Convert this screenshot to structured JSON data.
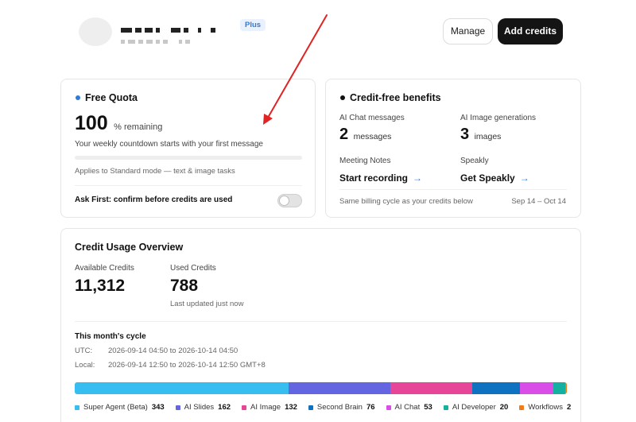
{
  "header": {
    "plan_badge": "Plus",
    "manage_label": "Manage",
    "add_credits_label": "Add credits"
  },
  "free_quota": {
    "title": "Free Quota",
    "percent": "100",
    "percent_suffix": "% remaining",
    "countdown_note": "Your weekly countdown starts with your first message",
    "used_fraction": 0,
    "applies_note": "Applies to Standard mode — text & image tasks",
    "ask_first_label": "Ask First: confirm before credits are used",
    "ask_first_enabled": false,
    "dot_color": "#2f7bd8"
  },
  "benefits": {
    "title": "Credit-free benefits",
    "chat_label": "AI Chat messages",
    "chat_count": "2",
    "chat_unit": "messages",
    "image_label": "AI Image generations",
    "image_count": "3",
    "image_unit": "images",
    "meeting_label": "Meeting Notes",
    "meeting_action": "Start recording",
    "speakly_label": "Speakly",
    "speakly_action": "Get Speakly",
    "arrow": "→",
    "billing_note": "Same billing cycle as your credits below",
    "billing_range": "Sep 14 – Oct 14"
  },
  "usage": {
    "title": "Credit Usage Overview",
    "available_label": "Available Credits",
    "available_value": "11,312",
    "used_label": "Used Credits",
    "used_value": "788",
    "updated_note": "Last updated just now",
    "cycle_title": "This month's cycle",
    "utc_label": "UTC:",
    "utc_range": "2026-09-14 04:50 to 2026-10-14 04:50",
    "local_label": "Local:",
    "local_range": "2026-09-14 12:50 to 2026-10-14 12:50 GMT+8",
    "segments": [
      {
        "name": "Super Agent (Beta)",
        "value": "343",
        "amount": 343,
        "color": "#38bdf0"
      },
      {
        "name": "AI Slides",
        "value": "162",
        "amount": 162,
        "color": "#6366e0"
      },
      {
        "name": "AI Image",
        "value": "132",
        "amount": 132,
        "color": "#e64598"
      },
      {
        "name": "Second Brain",
        "value": "76",
        "amount": 76,
        "color": "#0e72c0"
      },
      {
        "name": "AI Chat",
        "value": "53",
        "amount": 53,
        "color": "#d84ee6"
      },
      {
        "name": "AI Developer",
        "value": "20",
        "amount": 20,
        "color": "#14b0a0"
      },
      {
        "name": "Workflows",
        "value": "2",
        "amount": 2,
        "color": "#f07b18"
      }
    ]
  },
  "annotation": {
    "color": "#e02424"
  }
}
